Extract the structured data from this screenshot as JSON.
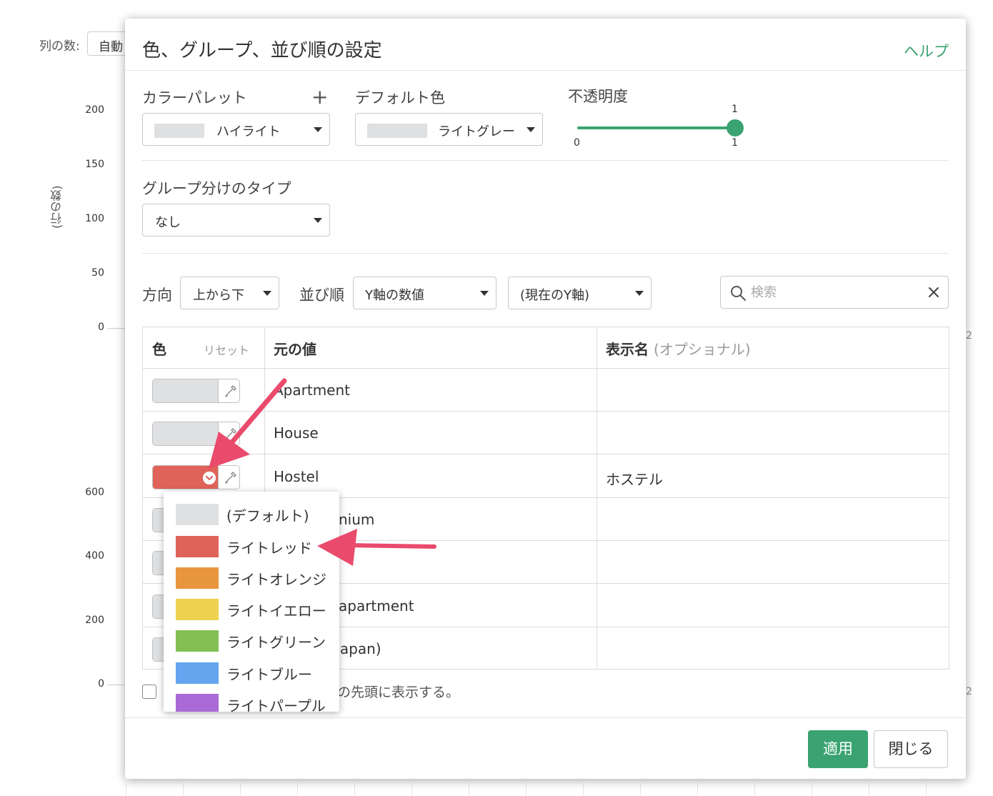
{
  "background": {
    "columns_label": "列の数:",
    "columns_value": "自動",
    "y_axis_label": "(行の数)",
    "top_ticks": [
      "200",
      "150",
      "100",
      "50",
      "0"
    ],
    "bottom_ticks": [
      "600",
      "400",
      "200",
      "0"
    ],
    "right_edge_labels": [
      "2",
      "2"
    ]
  },
  "modal": {
    "title": "色、グループ、並び順の設定",
    "help": "ヘルプ",
    "palette": {
      "label": "カラーパレット",
      "value": "ハイライト"
    },
    "default_color": {
      "label": "デフォルト色",
      "value": "ライトグレー"
    },
    "opacity": {
      "label": "不透明度",
      "min": "0",
      "max": "1",
      "current": "1",
      "fraction": 1.0
    },
    "grouping": {
      "label": "グループ分けのタイプ",
      "value": "なし"
    },
    "direction": {
      "label": "方向",
      "value": "上から下"
    },
    "sort": {
      "label": "並び順",
      "value": "Y軸の数値",
      "axis_value": "(現在のY軸)"
    },
    "search": {
      "placeholder": "検索"
    },
    "table": {
      "headers": {
        "color": "色",
        "reset": "リセット",
        "original": "元の値",
        "display_name": "表示名",
        "optional": "(オプショナル)"
      },
      "rows": [
        {
          "original": "Apartment",
          "display": ""
        },
        {
          "original": "House",
          "display": ""
        },
        {
          "original": "Hostel",
          "display": "ホステル"
        },
        {
          "original": "nium",
          "display": ""
        },
        {
          "original": "",
          "display": ""
        },
        {
          "original": "apartment",
          "display": ""
        },
        {
          "original": "Japan)",
          "display": ""
        }
      ]
    },
    "footnote": "の先頭に表示する。",
    "apply_button": "適用",
    "close_button": "閉じる"
  },
  "color_dropdown": {
    "items": [
      {
        "label": "(デフォルト)",
        "color": "#dfe0e2"
      },
      {
        "label": "ライトレッド",
        "color": "#df6358"
      },
      {
        "label": "ライトオレンジ",
        "color": "#e8963e"
      },
      {
        "label": "ライトイエロー",
        "color": "#edd250"
      },
      {
        "label": "ライトグリーン",
        "color": "#84bf54"
      },
      {
        "label": "ライトブルー",
        "color": "#63a5ef"
      },
      {
        "label": "ライトパープル",
        "color": "#a96ad6"
      }
    ]
  },
  "colors": {
    "accent": "#3aa371",
    "selected_row_color": "#df6358",
    "annotation_arrow": "#ea4a6c",
    "default_swatch": "#dfe0e2"
  }
}
